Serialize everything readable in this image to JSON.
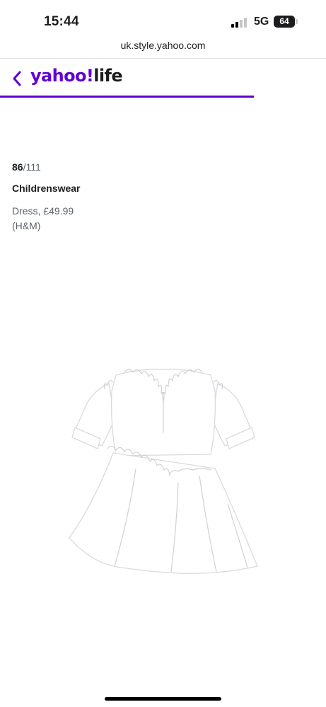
{
  "status_bar": {
    "time": "15:44",
    "network": "5G",
    "battery": "64"
  },
  "browser": {
    "url": "uk.style.yahoo.com"
  },
  "header": {
    "logo_yahoo": "yahoo!",
    "logo_life": "life",
    "accent_color": "#6001d2"
  },
  "slide": {
    "current": "86",
    "total": "/111",
    "category": "Childrenswear",
    "caption_line1": "Dress, £49.99",
    "caption_line2": "(H&M)"
  },
  "product_image": {
    "description_icon": "white-ruffle-dress"
  }
}
